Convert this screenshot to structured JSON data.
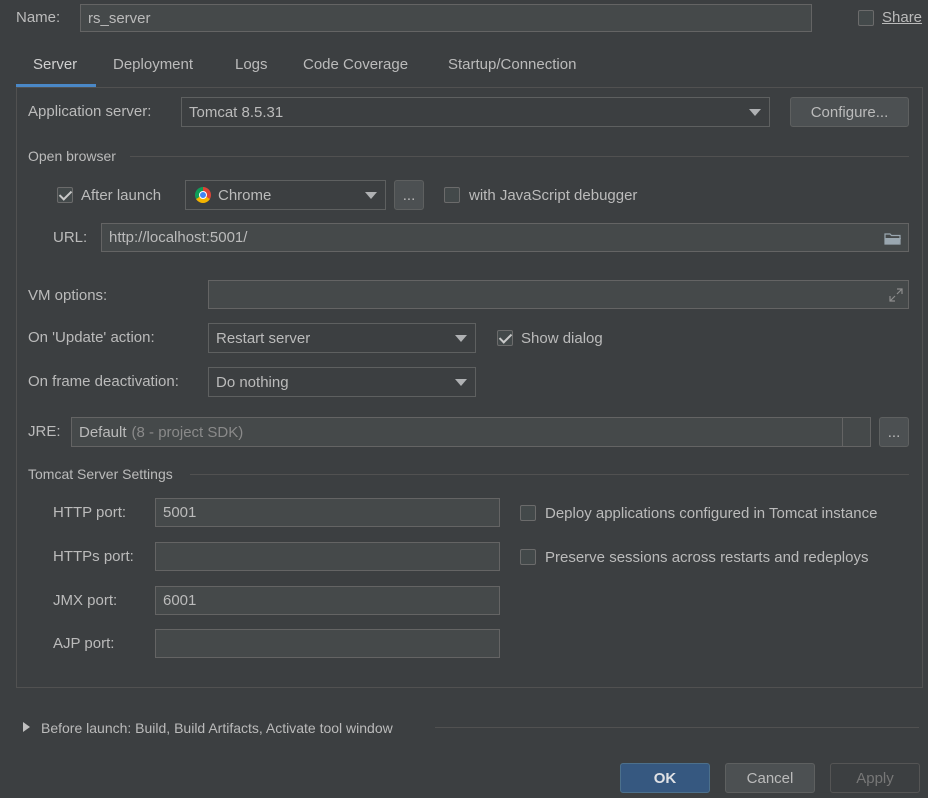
{
  "name_label": "Name:",
  "name_value": "rs_server",
  "share_label": "Share",
  "tabs": [
    "Server",
    "Deployment",
    "Logs",
    "Code Coverage",
    "Startup/Connection"
  ],
  "app_server": {
    "label": "Application server:",
    "value": "Tomcat 8.5.31",
    "configure": "Configure..."
  },
  "open_browser": {
    "title": "Open browser",
    "after_launch_label": "After launch",
    "browser": "Chrome",
    "more": "...",
    "js_debugger_label": "with JavaScript debugger",
    "url_label": "URL:",
    "url_value": "http://localhost:5001/"
  },
  "vm_options_label": "VM options:",
  "vm_options_value": "",
  "on_update": {
    "label": "On 'Update' action:",
    "value": "Restart server",
    "show_dialog_label": "Show dialog"
  },
  "on_frame": {
    "label": "On frame deactivation:",
    "value": "Do nothing"
  },
  "jre": {
    "label": "JRE:",
    "value": "Default",
    "hint": "(8 - project SDK)",
    "more": "..."
  },
  "tomcat": {
    "title": "Tomcat Server Settings",
    "http_label": "HTTP port:",
    "http_value": "5001",
    "https_label": "HTTPs port:",
    "https_value": "",
    "jmx_label": "JMX port:",
    "jmx_value": "6001",
    "ajp_label": "AJP port:",
    "ajp_value": "",
    "deploy_label": "Deploy applications configured in Tomcat instance",
    "preserve_label": "Preserve sessions across restarts and redeploys"
  },
  "before_launch": "Before launch: Build, Build Artifacts, Activate tool window",
  "buttons": {
    "ok": "OK",
    "cancel": "Cancel",
    "apply": "Apply"
  },
  "colors": {
    "background": "#3c3f41",
    "accent": "#365880",
    "tab_underline": "#4a88c7"
  }
}
